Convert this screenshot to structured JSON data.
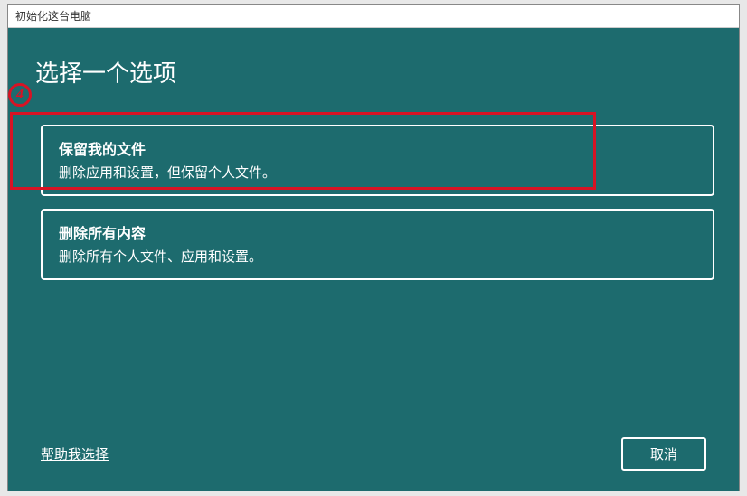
{
  "window": {
    "title": "初始化这台电脑"
  },
  "heading": "选择一个选项",
  "options": [
    {
      "title": "保留我的文件",
      "desc": "删除应用和设置，但保留个人文件。"
    },
    {
      "title": "删除所有内容",
      "desc": "删除所有个人文件、应用和设置。"
    }
  ],
  "helpLink": "帮助我选择",
  "cancel": "取消",
  "annotation": {
    "number": "4"
  }
}
